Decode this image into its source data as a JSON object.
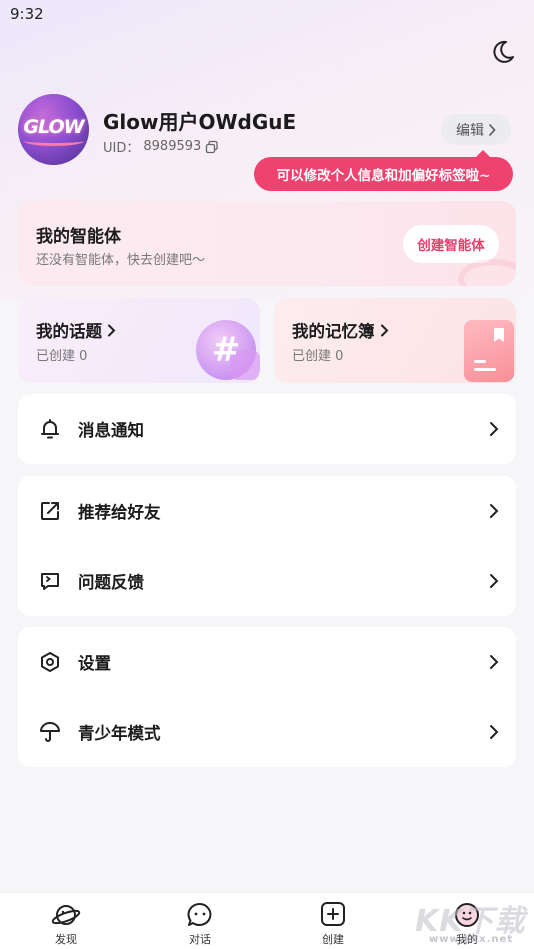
{
  "status_bar": {
    "time": "9:32"
  },
  "theme_toggle": {
    "icon": "moon-icon"
  },
  "profile": {
    "avatar_text": "GLOW",
    "username": "Glow用户OWdGuE",
    "uid_label": "UID：",
    "uid_value": "8989593",
    "edit_label": "编辑",
    "tooltip": "可以修改个人信息和加偏好标签啦~"
  },
  "agent_card": {
    "title": "我的智能体",
    "subtitle": "还没有智能体，快去创建吧～",
    "button": "创建智能体"
  },
  "topic_card": {
    "title": "我的话题",
    "subtitle": "已创建 0",
    "deco": "#"
  },
  "memo_card": {
    "title": "我的记忆簿",
    "subtitle": "已创建 0"
  },
  "menu": {
    "notifications": "消息通知",
    "recommend": "推荐给好友",
    "feedback": "问题反馈",
    "settings": "设置",
    "teen_mode": "青少年模式"
  },
  "bottom_nav": {
    "discover": "发现",
    "chat": "对话",
    "create": "创建",
    "mine": "我的"
  },
  "watermark": {
    "main": "KK下载",
    "sub": "www.kkx.net"
  },
  "colors": {
    "accent": "#f0426f",
    "background": "#f6f5f8"
  }
}
